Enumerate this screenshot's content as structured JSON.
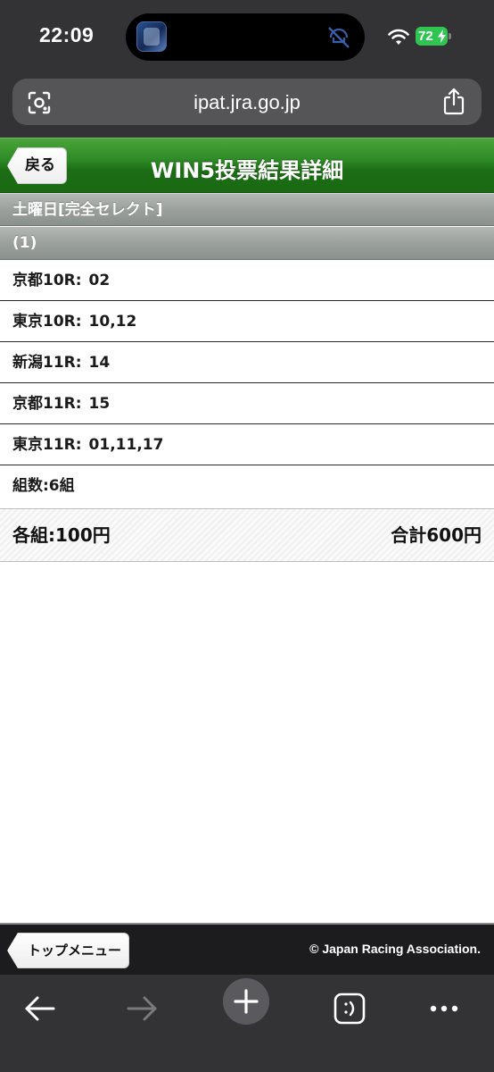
{
  "status_bar": {
    "time": "22:09",
    "battery": "72"
  },
  "browser": {
    "url": "ipat.jra.go.jp"
  },
  "header": {
    "back_label": "戻る",
    "title": "WIN5投票結果詳細"
  },
  "section": {
    "day_label": "土曜日[完全セレクト]",
    "group_label": "(1)"
  },
  "races": [
    {
      "race": "京都10R:",
      "selection": "02"
    },
    {
      "race": "東京10R:",
      "selection": "10,12"
    },
    {
      "race": "新潟11R:",
      "selection": "14"
    },
    {
      "race": "京都11R:",
      "selection": "15"
    },
    {
      "race": "東京11R:",
      "selection": "01,11,17"
    }
  ],
  "combo_count": "組数:6組",
  "summary": {
    "per_combo": "各組:100円",
    "total": "合計600円"
  },
  "footer": {
    "top_menu_label": "トップメニュー",
    "copyright": "© Japan Racing Association."
  },
  "icons": {
    "lens": "visual-search-icon",
    "share": "share-icon",
    "mute": "muted-notification-icon",
    "back": "arrow-left-icon",
    "forward": "arrow-right-icon",
    "new_tab": "plus-icon",
    "tabs": "tab-switcher-icon",
    "more": "more-dots-icon"
  },
  "colors": {
    "header_green": "#2e8a26",
    "section_gray": "#9aa09c",
    "battery_green": "#30c552",
    "chrome_dark": "#333336"
  }
}
